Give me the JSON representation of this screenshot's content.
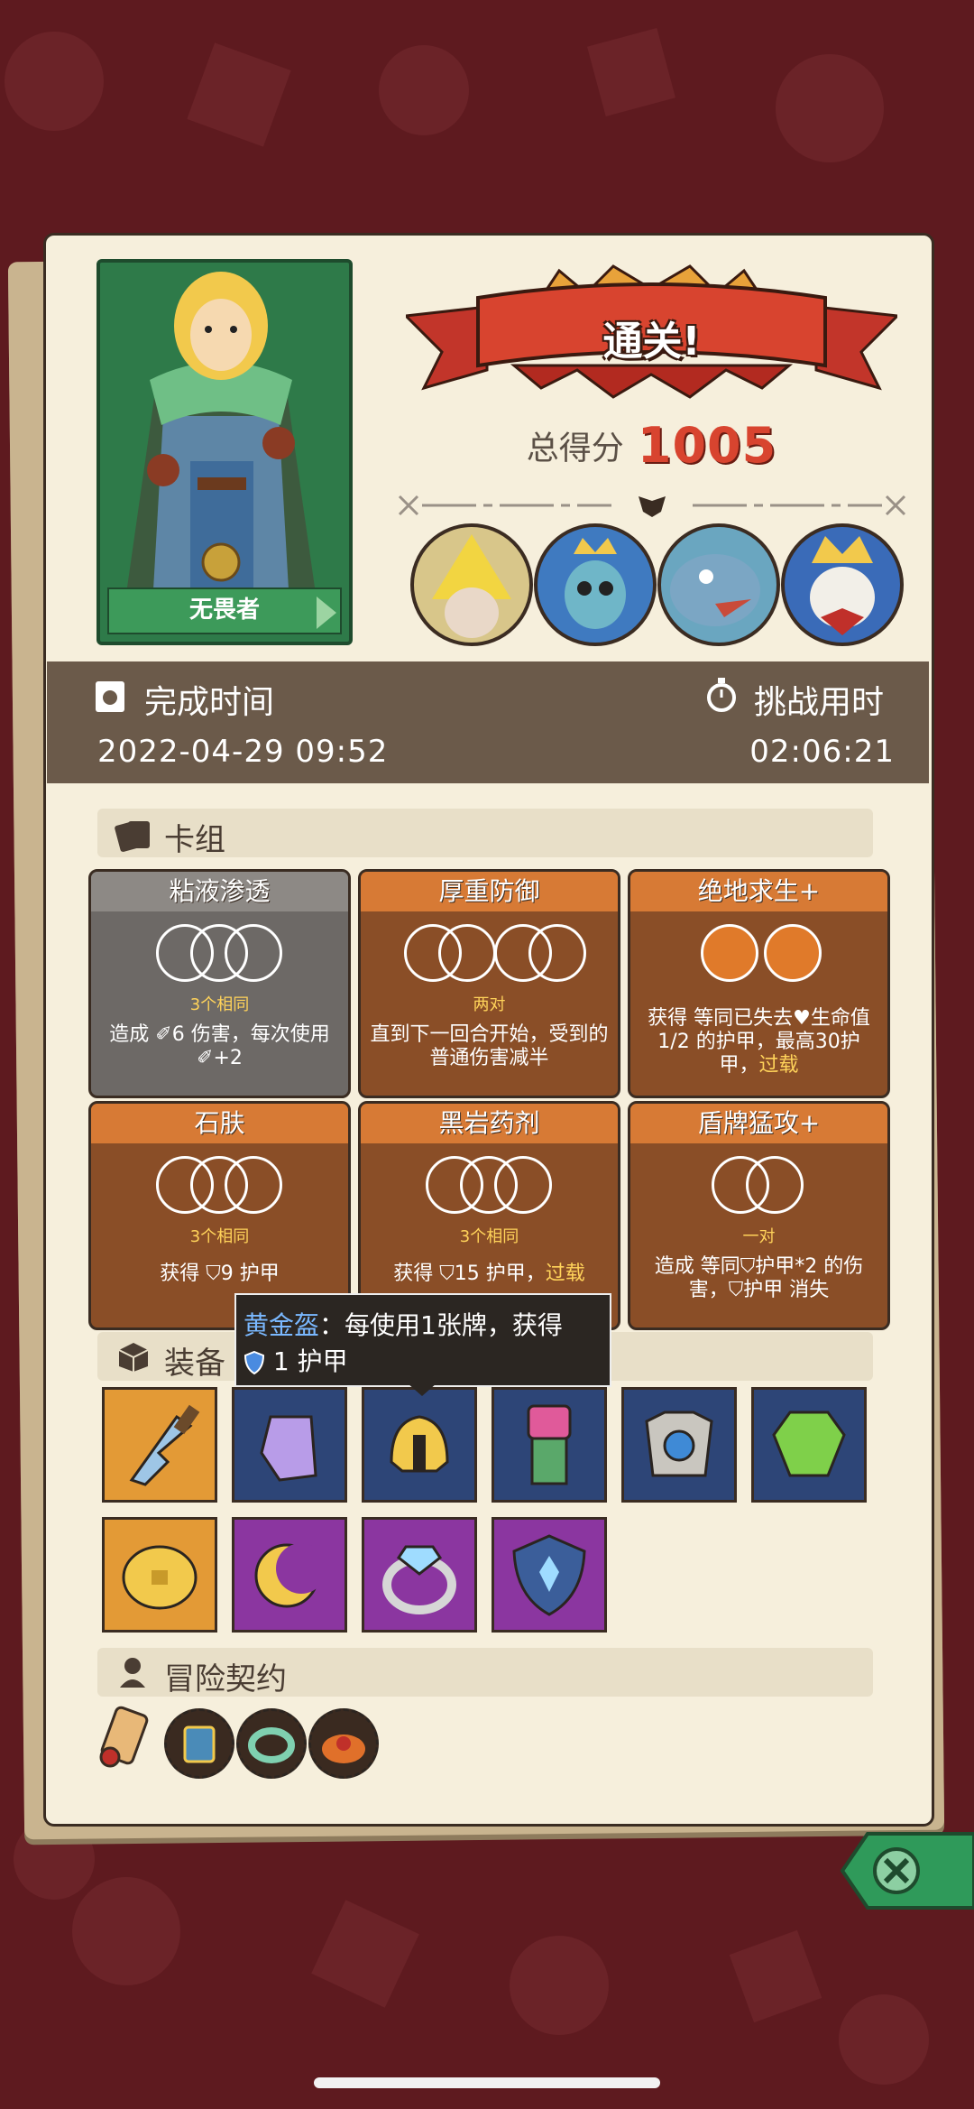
{
  "hero": {
    "name": "无畏者"
  },
  "result": {
    "banner": "通关!",
    "score_label": "总得分",
    "score_value": "1005"
  },
  "times": {
    "finish_label": "完成时间",
    "finish_value": "2022-04-29 09:52",
    "challenge_label": "挑战用时",
    "challenge_value": "02:06:21"
  },
  "deck": {
    "title": "卡组",
    "cards": [
      {
        "name": "粘液渗透",
        "style": "gray",
        "req": "3个相同",
        "desc": "造成 ✐6 伤害，每次使用 ✐+2"
      },
      {
        "name": "厚重防御",
        "style": "orange",
        "req": "两对",
        "desc": "直到下一回合开始，受到的普通伤害减半"
      },
      {
        "name": "绝地求生+",
        "style": "orange",
        "req": "",
        "desc": "获得 等同已失去♥生命值1/2 的护甲，最高30护甲，",
        "desc_hl": "过载"
      },
      {
        "name": "石肤",
        "style": "orange",
        "req": "3个相同",
        "desc": "获得 ⛉9 护甲"
      },
      {
        "name": "黑岩药剂",
        "style": "orange",
        "req": "3个相同",
        "desc": "获得 ⛉15 护甲，",
        "desc_hl": "过载"
      },
      {
        "name": "盾牌猛攻+",
        "style": "orange",
        "req": "一对",
        "desc": "造成 等同⛉护甲*2 的伤害，⛉护甲 消失"
      }
    ]
  },
  "tooltip": {
    "name": "黄金盔",
    "sep": "：",
    "text1": "每使用1张牌，获得",
    "text2": "1 护甲"
  },
  "equipment": {
    "title": "装备",
    "items": [
      {
        "name": "broken-blade-icon",
        "color": "orange"
      },
      {
        "name": "cape-icon",
        "color": "blue"
      },
      {
        "name": "golden-helmet-icon",
        "color": "blue"
      },
      {
        "name": "totem-icon",
        "color": "blue"
      },
      {
        "name": "chest-armor-icon",
        "color": "blue"
      },
      {
        "name": "emerald-icon",
        "color": "blue"
      },
      {
        "name": "gold-coin-icon",
        "color": "orange"
      },
      {
        "name": "moon-charm-icon",
        "color": "purple"
      },
      {
        "name": "diamond-ring-icon",
        "color": "purple"
      },
      {
        "name": "crystal-shield-icon",
        "color": "purple"
      }
    ]
  },
  "contract": {
    "title": "冒险契约"
  },
  "colors": {
    "accent_red": "#d8442f",
    "gold_text": "#ffd35a",
    "paper": "#f6efdc",
    "bg": "#5e1a1f"
  }
}
